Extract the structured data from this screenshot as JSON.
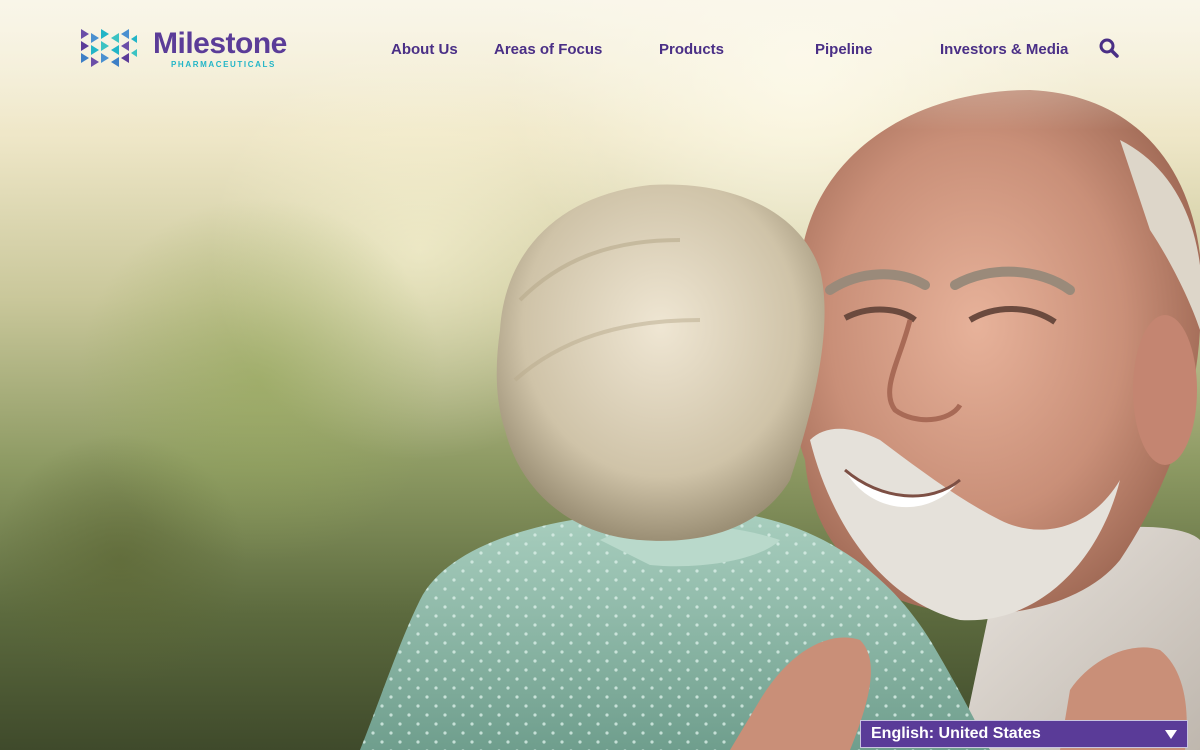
{
  "brand": {
    "name": "Milestone",
    "tagline": "PHARMACEUTICALS",
    "logo_icon": "triangle-pattern-logo-icon",
    "primary_color": "#5b3c98",
    "accent_color": "#22b5c7"
  },
  "nav": {
    "items": [
      {
        "label": "About Us"
      },
      {
        "label": "Areas of Focus"
      },
      {
        "label": "Products"
      },
      {
        "label": "Pipeline"
      },
      {
        "label": "Investors & Media"
      }
    ],
    "search_icon": "search-icon"
  },
  "language_selector": {
    "value": "English: United States",
    "icon": "caret-down-icon"
  }
}
